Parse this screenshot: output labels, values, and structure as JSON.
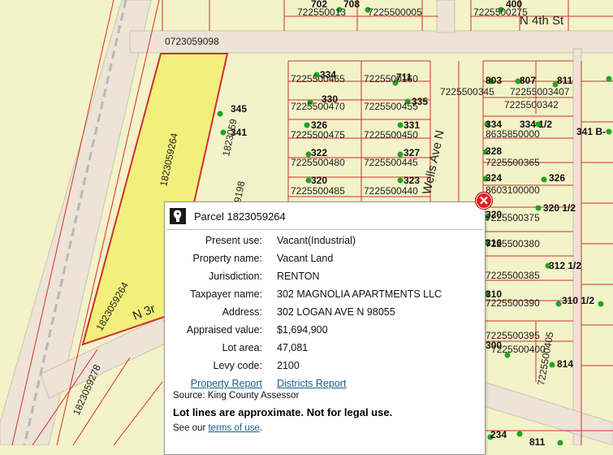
{
  "map": {
    "streets": {
      "n_4th": "N 4th St",
      "n_3rd": "N 3r",
      "vertical_road": "Wells Ave N"
    },
    "parcel_numbers": {
      "top_road": "0723059098",
      "highlight_upper": "1823059264",
      "highlight_lower": "1823059264",
      "left_lower": "1823059278",
      "mid_a": "1823059",
      "mid_b": "9198",
      "row_top_a": "722550013",
      "row_top_b": "7225500005",
      "row_top_c": "7225500275",
      "r465": "7225500465",
      "r160": "7225500160",
      "r470": "7225500470",
      "r455": "7225500455",
      "r475": "7225500475",
      "r450": "7225500450",
      "r480": "7225500480",
      "r445": "7225500445",
      "r485": "7225500485",
      "r440": "7225500440",
      "r345": "7225500345",
      "r340": "72255003407",
      "r342": "7225500342",
      "r863585": "8635850000",
      "r365": "7225500365",
      "r863310": "8603100000",
      "r375": "7225500375",
      "r380": "7225500380",
      "r385": "7225500385",
      "r390": "7225500390",
      "r395": "7225500395",
      "r400": "7225500400",
      "r405": "7225500405"
    },
    "house_numbers": {
      "h702": "702",
      "h708": "708",
      "h400": "400",
      "h345": "345",
      "h341": "341",
      "h334": "334",
      "h711": "711",
      "h330": "330",
      "h335": "335",
      "h326": "326",
      "h331": "331",
      "h322": "322",
      "h327": "327",
      "h320": "320",
      "h323": "323",
      "h803": "803",
      "h807": "807",
      "h811": "811",
      "h334r": "334",
      "h334h": "334 1/2",
      "h341b": "341 B-",
      "h328": "328",
      "h324": "324",
      "h326r": "326",
      "h320h": "320 1/2",
      "h320r": "320",
      "h316": "316",
      "h312h": "312 1/2",
      "h310": "310",
      "h310h": "310 1/2",
      "h300": "300",
      "h814": "814",
      "h234": "234",
      "h811b": "811"
    }
  },
  "popup": {
    "title": "Parcel 1823059264",
    "fields": [
      {
        "label": "Present use:",
        "value": "Vacant(Industrial)"
      },
      {
        "label": "Property name:",
        "value": "Vacant Land"
      },
      {
        "label": "Jurisdiction:",
        "value": "RENTON"
      },
      {
        "label": "Taxpayer name:",
        "value": "302 MAGNOLIA APARTMENTS LLC"
      },
      {
        "label": "Address:",
        "value": "302 LOGAN AVE N 98055"
      },
      {
        "label": "Appraised value:",
        "value": "$1,694,900"
      },
      {
        "label": "Lot area:",
        "value": "47,081"
      },
      {
        "label": "Levy code:",
        "value": "2100"
      }
    ],
    "property_report_link": "Property Report",
    "districts_report_link": "Districts Report",
    "source": "Source: King County Assessor",
    "disclaimer": "Lot lines are approximate. Not for legal use.",
    "terms_prefix": "See our ",
    "terms_link": "terms of use",
    "terms_suffix": ".",
    "close_symbol": "✕"
  },
  "colors": {
    "background": "#f4f2c8",
    "road": "#ede3d6",
    "parcel_line": "#d03030",
    "highlight_fill": "#f2f07a",
    "address_dot": "#1fa51f",
    "link": "#1a5e8a",
    "close_button": "#e02020"
  }
}
